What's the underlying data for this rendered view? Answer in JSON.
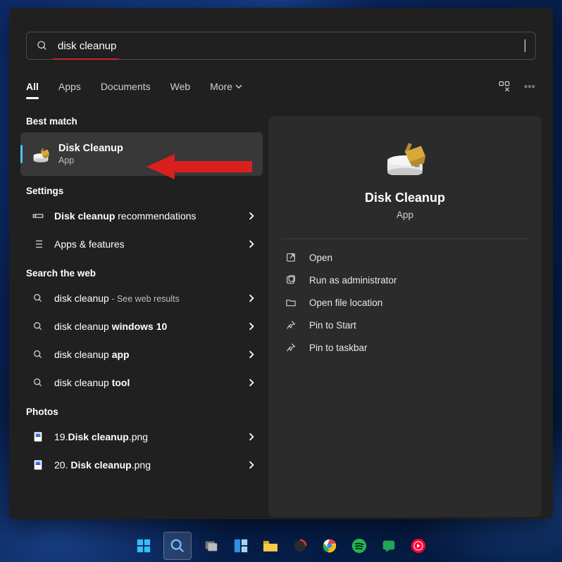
{
  "search": {
    "value": "disk cleanup"
  },
  "tabs": {
    "t0": "All",
    "t1": "Apps",
    "t2": "Documents",
    "t3": "Web",
    "t4": "More"
  },
  "left": {
    "best_match_label": "Best match",
    "best_match": {
      "title": "Disk Cleanup",
      "type": "App"
    },
    "settings_label": "Settings",
    "settings": [
      {
        "pre": "Disk cleanup",
        "post": " recommendations"
      },
      {
        "pre": "",
        "post": "Apps & features"
      }
    ],
    "web_label": "Search the web",
    "web": [
      {
        "pre": "disk cleanup",
        "mid": " - ",
        "sub": "See web results",
        "bold": ""
      },
      {
        "pre": "disk cleanup ",
        "bold": "windows 10"
      },
      {
        "pre": "disk cleanup ",
        "bold": "app"
      },
      {
        "pre": "disk cleanup ",
        "bold": "tool"
      }
    ],
    "photos_label": "Photos",
    "photos": [
      {
        "pre": "19.",
        "bold": "Disk cleanup",
        "post": ".png"
      },
      {
        "pre": "20. ",
        "bold": "Disk cleanup",
        "post": ".png"
      }
    ]
  },
  "right": {
    "title": "Disk Cleanup",
    "type": "App",
    "actions": {
      "a0": "Open",
      "a1": "Run as administrator",
      "a2": "Open file location",
      "a3": "Pin to Start",
      "a4": "Pin to taskbar"
    }
  },
  "colors": {
    "accent": "#4cc2ff",
    "annotation": "#da1f1f"
  }
}
